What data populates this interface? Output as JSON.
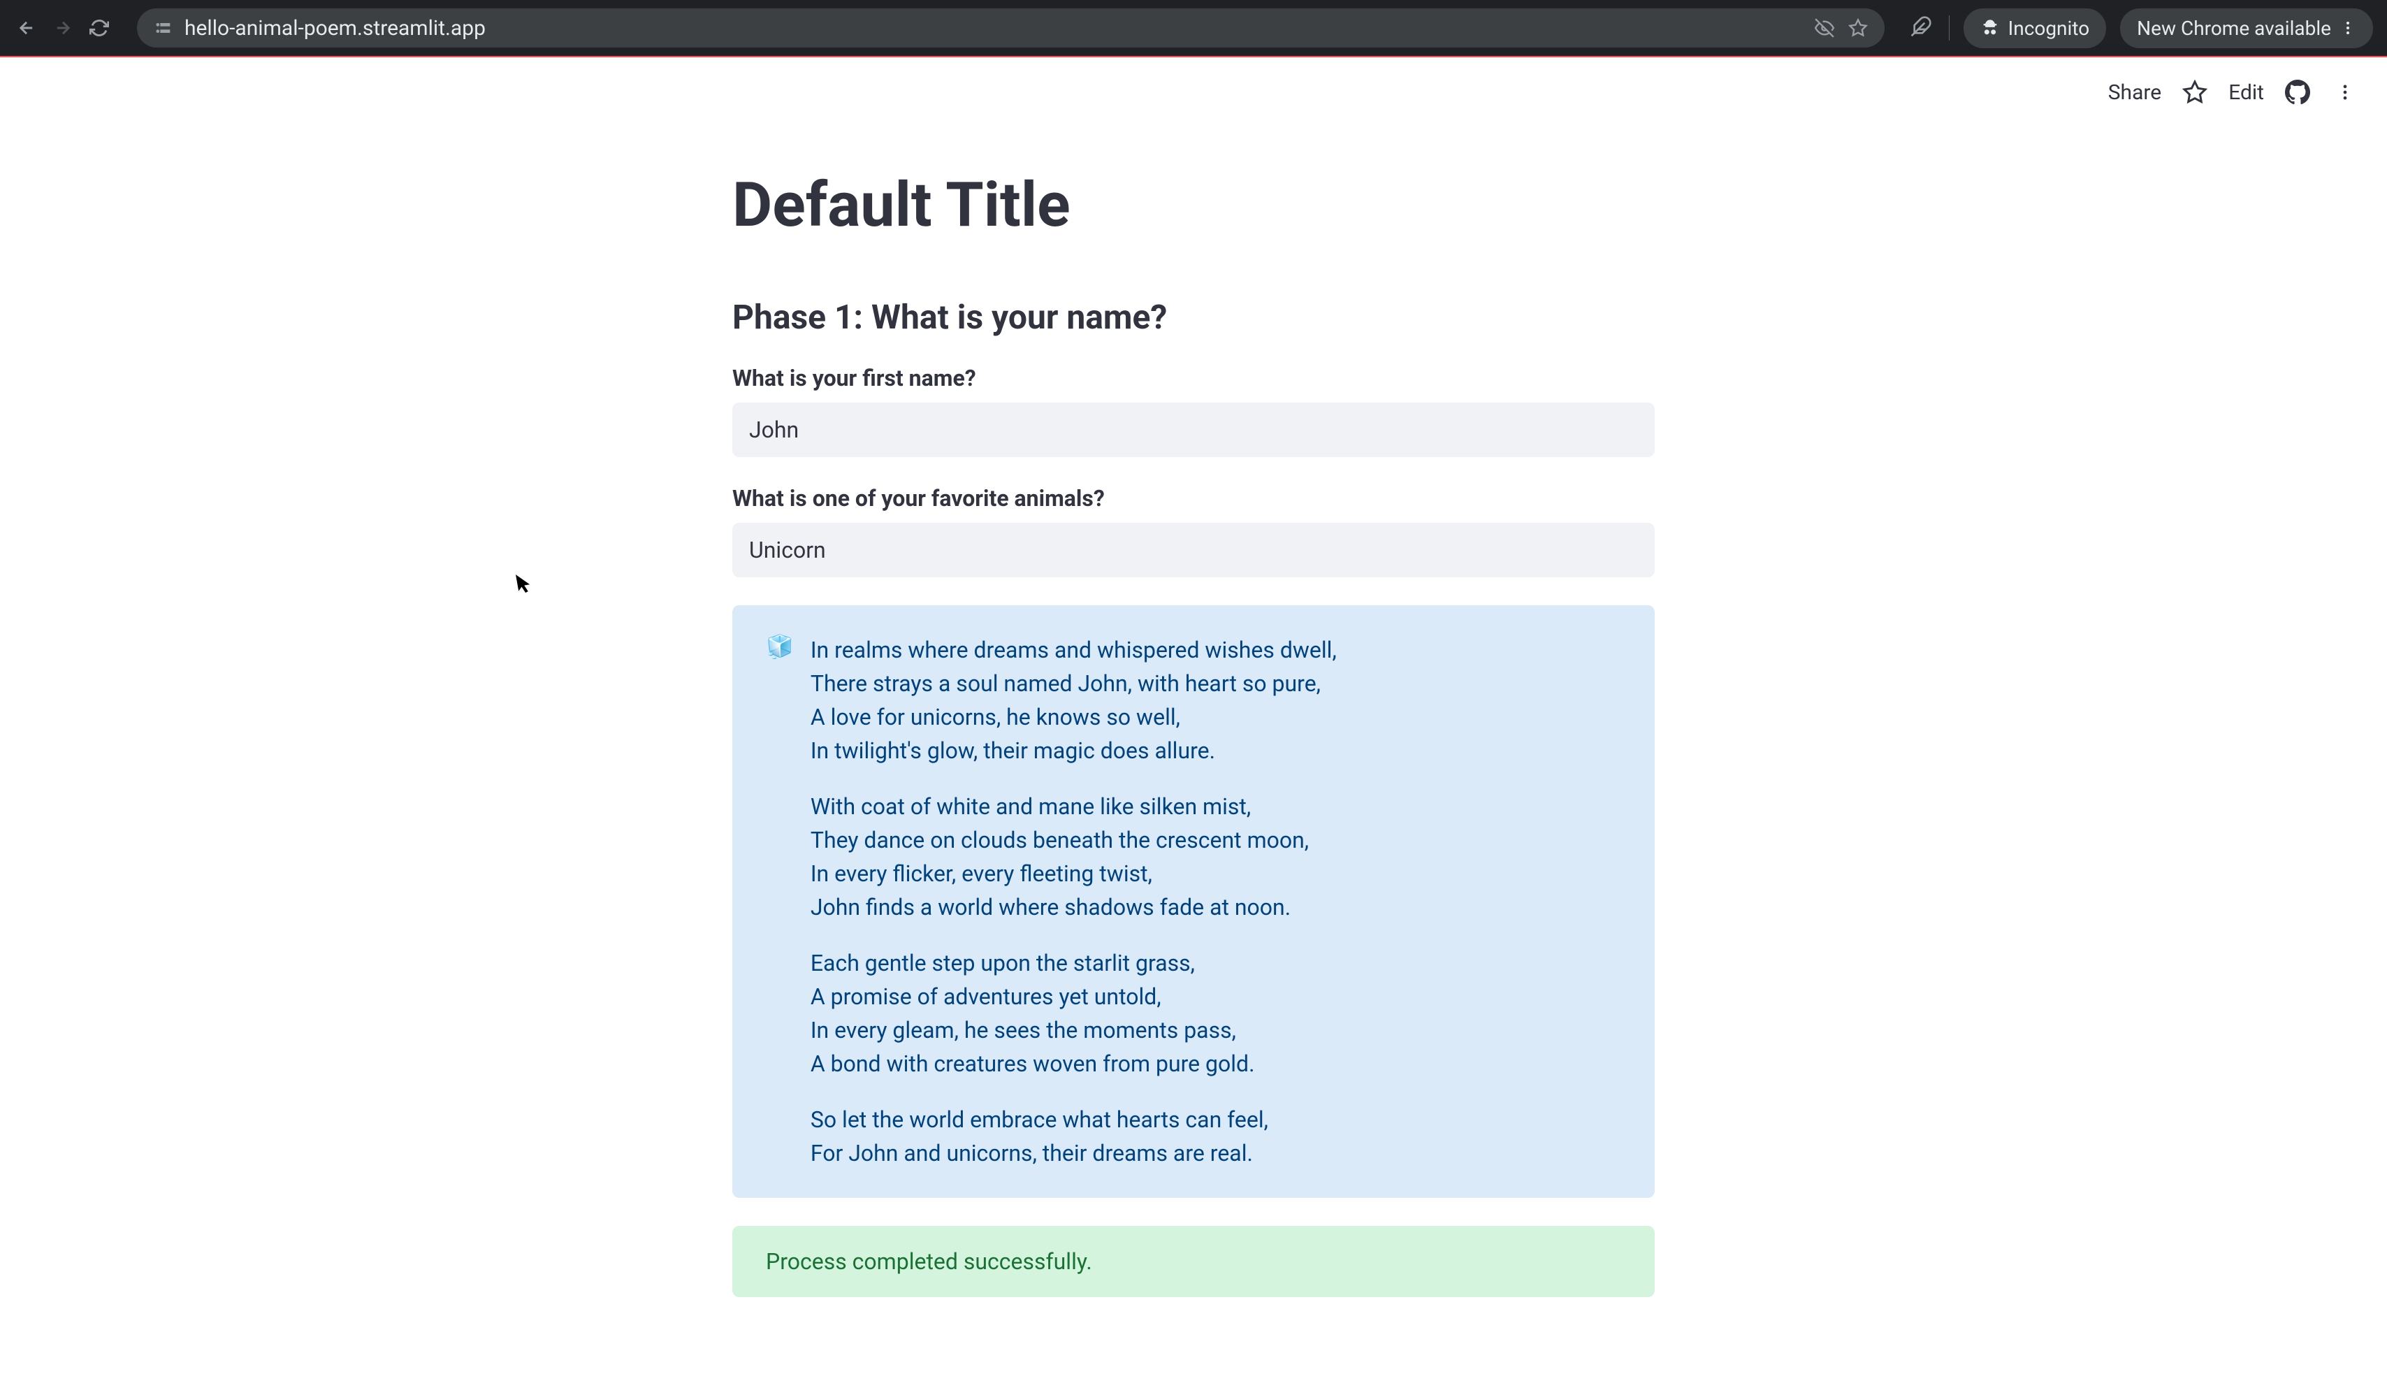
{
  "browser": {
    "url": "hello-animal-poem.streamlit.app",
    "incognito_label": "Incognito",
    "update_label": "New Chrome available"
  },
  "header": {
    "share": "Share",
    "edit": "Edit"
  },
  "page": {
    "title": "Default Title",
    "subheader": "Phase 1: What is your name?",
    "name_label": "What is your first name?",
    "name_value": "John",
    "animal_label": "What is one of your favorite animals?",
    "animal_value": "Unicorn"
  },
  "info_icon": "🧊",
  "poem": {
    "stanzas": [
      [
        "In realms where dreams and whispered wishes dwell,",
        "There strays a soul named John, with heart so pure,",
        "A love for unicorns, he knows so well,",
        "In twilight's glow, their magic does allure."
      ],
      [
        "With coat of white and mane like silken mist,",
        "They dance on clouds beneath the crescent moon,",
        "In every flicker, every fleeting twist,",
        "John finds a world where shadows fade at noon."
      ],
      [
        "Each gentle step upon the starlit grass,",
        "A promise of adventures yet untold,",
        "In every gleam, he sees the moments pass,",
        "A bond with creatures woven from pure gold."
      ],
      [
        "So let the world embrace what hearts can feel,",
        "For John and unicorns, their dreams are real."
      ]
    ]
  },
  "success_message": "Process completed successfully."
}
